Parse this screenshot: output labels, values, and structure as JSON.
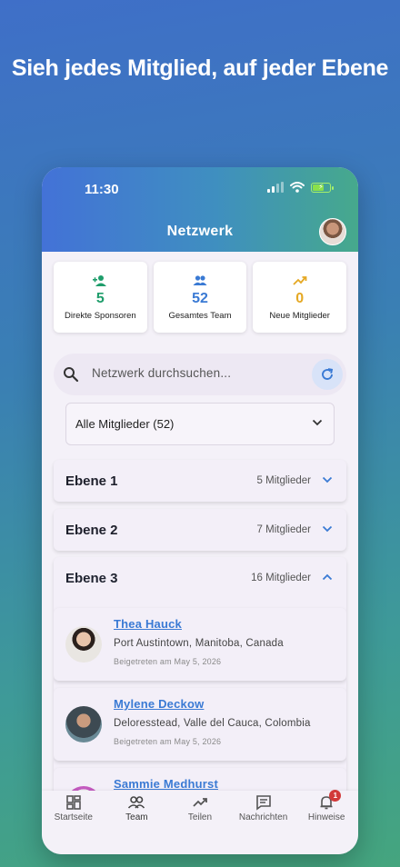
{
  "headline": "Sieh jedes Mitglied, auf jeder Ebene",
  "status": {
    "time": "11:30"
  },
  "header": {
    "title": "Netzwerk"
  },
  "stats": [
    {
      "value": "5",
      "label": "Direkte Sponsoren",
      "color": "#1f9d6b",
      "icon": "person-add-icon"
    },
    {
      "value": "52",
      "label": "Gesamtes Team",
      "color": "#3a7ad4",
      "icon": "group-icon"
    },
    {
      "value": "0",
      "label": "Neue Mitglieder",
      "color": "#e5a823",
      "icon": "trending-up-icon"
    }
  ],
  "search": {
    "placeholder": "Netzwerk durchsuchen..."
  },
  "filter": {
    "selected": "Alle Mitglieder (52)"
  },
  "levels": [
    {
      "name": "Ebene 1",
      "count": "5 Mitglieder"
    },
    {
      "name": "Ebene 2",
      "count": "7 Mitglieder"
    },
    {
      "name": "Ebene 3",
      "count": "16 Mitglieder"
    }
  ],
  "members": [
    {
      "name": "Thea Hauck",
      "location": "Port Austintown, Manitoba, Canada",
      "joined": "Beigetreten am May 5, 2026"
    },
    {
      "name": "Mylene Deckow",
      "location": "Deloresstead, Valle del Cauca, Colombia",
      "joined": "Beigetreten am May 5, 2026"
    },
    {
      "name": "Sammie Medhurst",
      "location": "",
      "joined": ""
    }
  ],
  "nav": [
    {
      "label": "Startseite",
      "icon": "dashboard-icon"
    },
    {
      "label": "Team",
      "icon": "team-icon"
    },
    {
      "label": "Teilen",
      "icon": "trending-icon"
    },
    {
      "label": "Nachrichten",
      "icon": "message-icon"
    },
    {
      "label": "Hinweise",
      "icon": "bell-icon",
      "badge": "1"
    }
  ],
  "colors": {
    "link": "#3a7ad4",
    "accent": "#3a7ad4",
    "badge": "#d23a3a"
  }
}
